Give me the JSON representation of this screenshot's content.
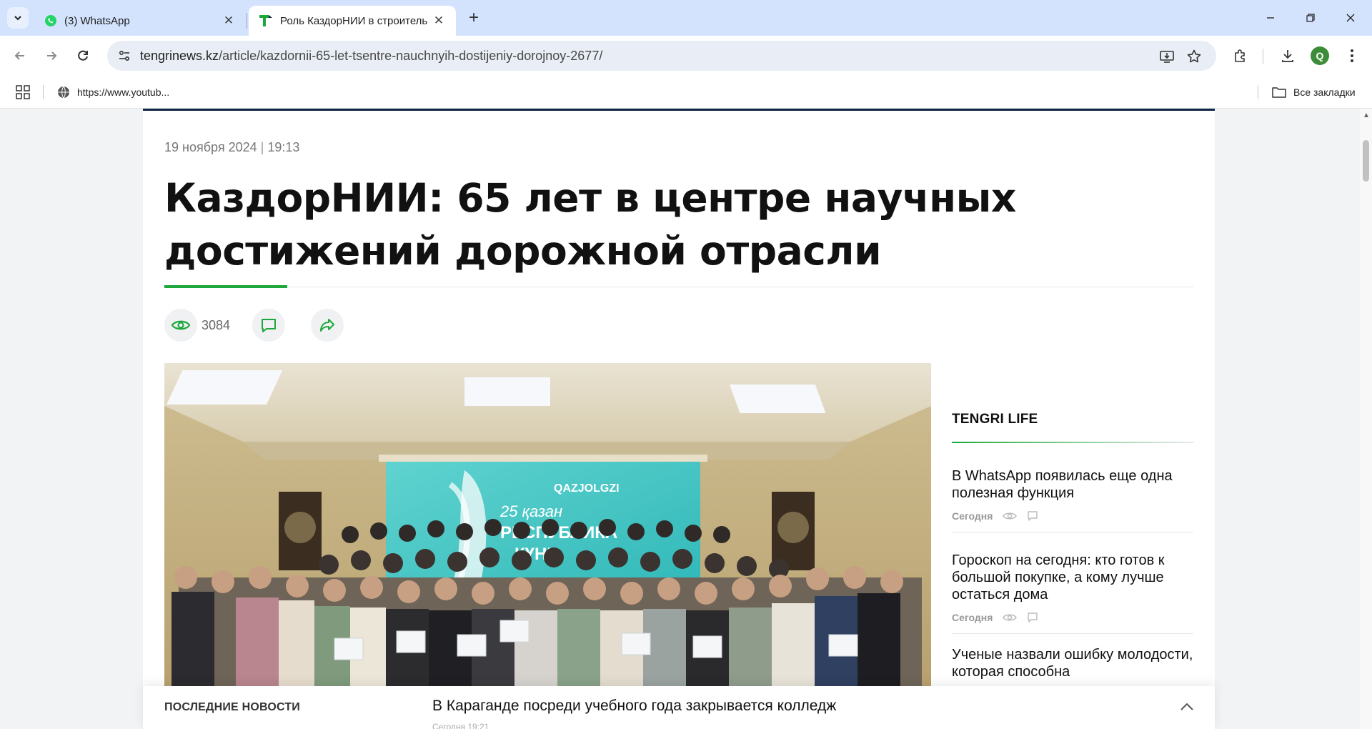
{
  "browser": {
    "tabs": [
      {
        "title": "(3) WhatsApp",
        "active": false,
        "favicon": "whatsapp-icon"
      },
      {
        "title": "Роль КаздорНИИ в строитель",
        "active": true,
        "favicon": "tengrinews-icon"
      }
    ],
    "url": {
      "host": "tengrinews.kz",
      "path": "/article/kazdornii-65-let-tsentre-nauchnyih-dostijeniy-dorojnoy-2677/"
    },
    "profile_initial": "Q",
    "bookmarks": {
      "item": "https://www.youtub...",
      "all_label": "Все закладки"
    }
  },
  "article": {
    "date": "19 ноября 2024",
    "time": "19:13",
    "title": "КаздорНИИ: 65 лет в центре научных достижений дорожной отрасли",
    "views": "3084",
    "photo": {
      "screen_logo": "QAZJOLGZI",
      "screen_line1": "25 қазан",
      "screen_line2": "РЕСПУБЛИКА",
      "screen_line3": "КҮНІ"
    }
  },
  "sidebar": {
    "heading": "TENGRI LIFE",
    "items": [
      {
        "title": "В WhatsApp появилась еще одна полезная функция",
        "meta": "Сегодня"
      },
      {
        "title": "Гороскоп на сегодня: кто готов к большой покупке, а кому лучше остаться дома",
        "meta": "Сегодня"
      },
      {
        "title": "Ученые назвали ошибку молодости, которая способна",
        "meta": ""
      }
    ]
  },
  "latest": {
    "label": "ПОСЛЕДНИЕ НОВОСТИ",
    "headline": "В Караганде посреди учебного года закрывается колледж",
    "time": "Сегодня 19:21"
  },
  "colors": {
    "accent": "#1ea83c",
    "navy": "#0e2746",
    "tabstrip": "#d3e3fd"
  }
}
